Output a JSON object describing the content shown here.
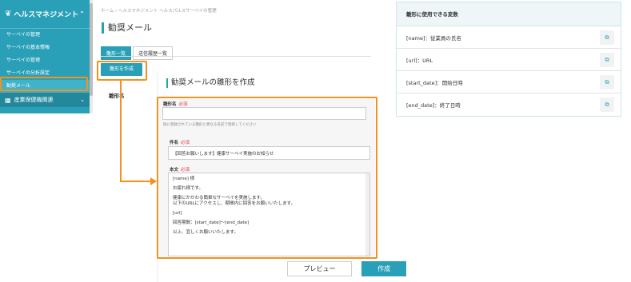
{
  "sidebar": {
    "header": {
      "icon": "leaf-icon",
      "title": "ヘルスマネジメント",
      "chevron": "⌃"
    },
    "items": [
      {
        "label": "サーベイの管理"
      },
      {
        "label": "サーベイの基本情報"
      },
      {
        "label": "サーベイの管理"
      },
      {
        "label": "サーベイの分析設定"
      },
      {
        "label": "勧奨メール",
        "active": true
      }
    ],
    "section": {
      "icon": "building-icon",
      "title": "産業保健機関連",
      "chevron": "⌄"
    }
  },
  "main": {
    "breadcrumb": "ホーム  ›  ヘルスマネジメント ヘルスパルスサーベイの管理",
    "title": "勧奨メール",
    "tabs": [
      {
        "label": "雛形一覧",
        "active": true
      },
      {
        "label": "送信履歴一覧",
        "active": false
      }
    ],
    "create_template_button": "雛形を作成",
    "template_label": "雛形名"
  },
  "modal": {
    "title": "勧奨メールの雛形を作成",
    "template_name": {
      "label": "雛形名",
      "required": "必須",
      "value": "",
      "hint": "既に登録されている雛形と異なる名前で登録してください"
    },
    "subject": {
      "label": "件名",
      "required": "必須",
      "value": "【回答お願いします】健康サーベイ実施のお知らせ"
    },
    "body": {
      "label": "本文",
      "required": "必須",
      "lines": [
        "[name] 様",
        "",
        "お疲れ様です。",
        "",
        "健康にかかわる簡単なサーベイを実施します。",
        "以下のURLにアクセスし、期間内に回答をお願いいたします。",
        "",
        "[url]",
        "",
        "回答期間：[start_date]〜[end_date]",
        "",
        "以上、宜しくお願いいたします。"
      ]
    },
    "preview_button": "プレビュー",
    "create_button": "作成"
  },
  "variables": {
    "title": "雛形に使用できる変数",
    "items": [
      {
        "label": "[name]：従業員の氏名"
      },
      {
        "label": "[url]：URL"
      },
      {
        "label": "[start_date]：開始日時"
      },
      {
        "label": "[end_date]：終了日時"
      }
    ],
    "copy_icon": "copy-icon"
  },
  "colors": {
    "accent": "#2aa0b8",
    "highlight": "#f2921c",
    "required": "#e04040"
  }
}
